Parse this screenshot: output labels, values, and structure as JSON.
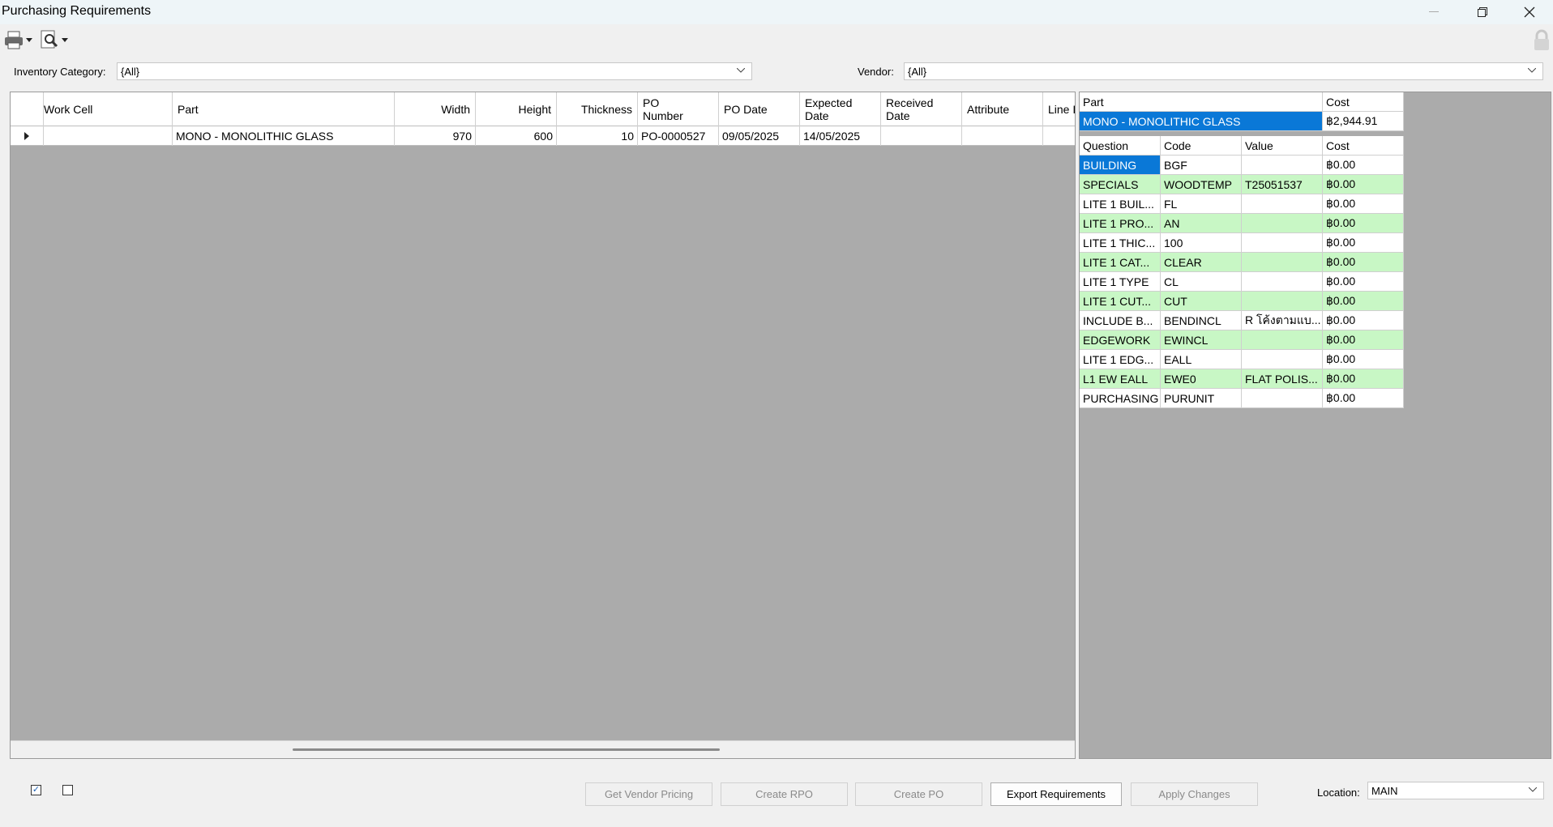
{
  "window": {
    "title": "Purchasing Requirements"
  },
  "filters": {
    "inventory_category_label": "Inventory Category:",
    "inventory_category_value": "{All}",
    "vendor_label": "Vendor:",
    "vendor_value": "{All}"
  },
  "grid": {
    "columns": [
      "Work Cell",
      "Part",
      "Width",
      "Height",
      "Thickness",
      "PO\nNumber",
      "PO Date",
      "Expected\nDate",
      "Received\nDate",
      "Attribute",
      "Line I"
    ],
    "row": {
      "work_cell": "",
      "part": "MONO - MONOLITHIC GLASS",
      "width": "970",
      "height": "600",
      "thickness": "10",
      "po_number": "PO-0000527",
      "po_date": "09/05/2025",
      "expected_date": "14/05/2025",
      "received_date": "",
      "attribute": ""
    }
  },
  "part_summary": {
    "header_part": "Part",
    "header_cost": "Cost",
    "part": "MONO - MONOLITHIC GLASS",
    "cost": "฿2,944.91"
  },
  "options": {
    "headers": [
      "Question",
      "Code",
      "Value",
      "Cost"
    ],
    "rows": [
      {
        "question": "BUILDING",
        "code": "BGF",
        "value": "",
        "cost": "฿0.00"
      },
      {
        "question": "SPECIALS",
        "code": "WOODTEMP",
        "value": "T25051537",
        "cost": "฿0.00"
      },
      {
        "question": "LITE 1 BUIL...",
        "code": "FL",
        "value": "",
        "cost": "฿0.00"
      },
      {
        "question": "LITE 1 PRO...",
        "code": "AN",
        "value": "",
        "cost": "฿0.00"
      },
      {
        "question": "LITE 1 THIC...",
        "code": "100",
        "value": "",
        "cost": "฿0.00"
      },
      {
        "question": "LITE 1 CAT...",
        "code": "CLEAR",
        "value": "",
        "cost": "฿0.00"
      },
      {
        "question": "LITE 1 TYPE",
        "code": "CL",
        "value": "",
        "cost": "฿0.00"
      },
      {
        "question": "LITE 1 CUT...",
        "code": "CUT",
        "value": "",
        "cost": "฿0.00"
      },
      {
        "question": "INCLUDE B...",
        "code": "BENDINCL",
        "value": "R โค้งตามแบ...",
        "cost": "฿0.00"
      },
      {
        "question": "EDGEWORK",
        "code": "EWINCL",
        "value": "",
        "cost": "฿0.00"
      },
      {
        "question": "LITE 1 EDG...",
        "code": "EALL",
        "value": "",
        "cost": "฿0.00"
      },
      {
        "question": "L1 EW EALL",
        "code": "EWE0",
        "value": "FLAT POLIS...",
        "cost": "฿0.00"
      },
      {
        "question": "PURCHASING",
        "code": "PURUNIT",
        "value": "",
        "cost": "฿0.00"
      }
    ]
  },
  "footer": {
    "check1": "✓",
    "get_vendor_pricing": "Get Vendor Pricing",
    "create_rpo": "Create RPO",
    "create_po": "Create PO",
    "export_requirements": "Export Requirements",
    "apply_changes": "Apply Changes",
    "location_label": "Location:",
    "location_value": "MAIN"
  },
  "icons": {
    "print": "printer-icon",
    "preview": "print-preview-icon",
    "lock": "lock-icon"
  }
}
